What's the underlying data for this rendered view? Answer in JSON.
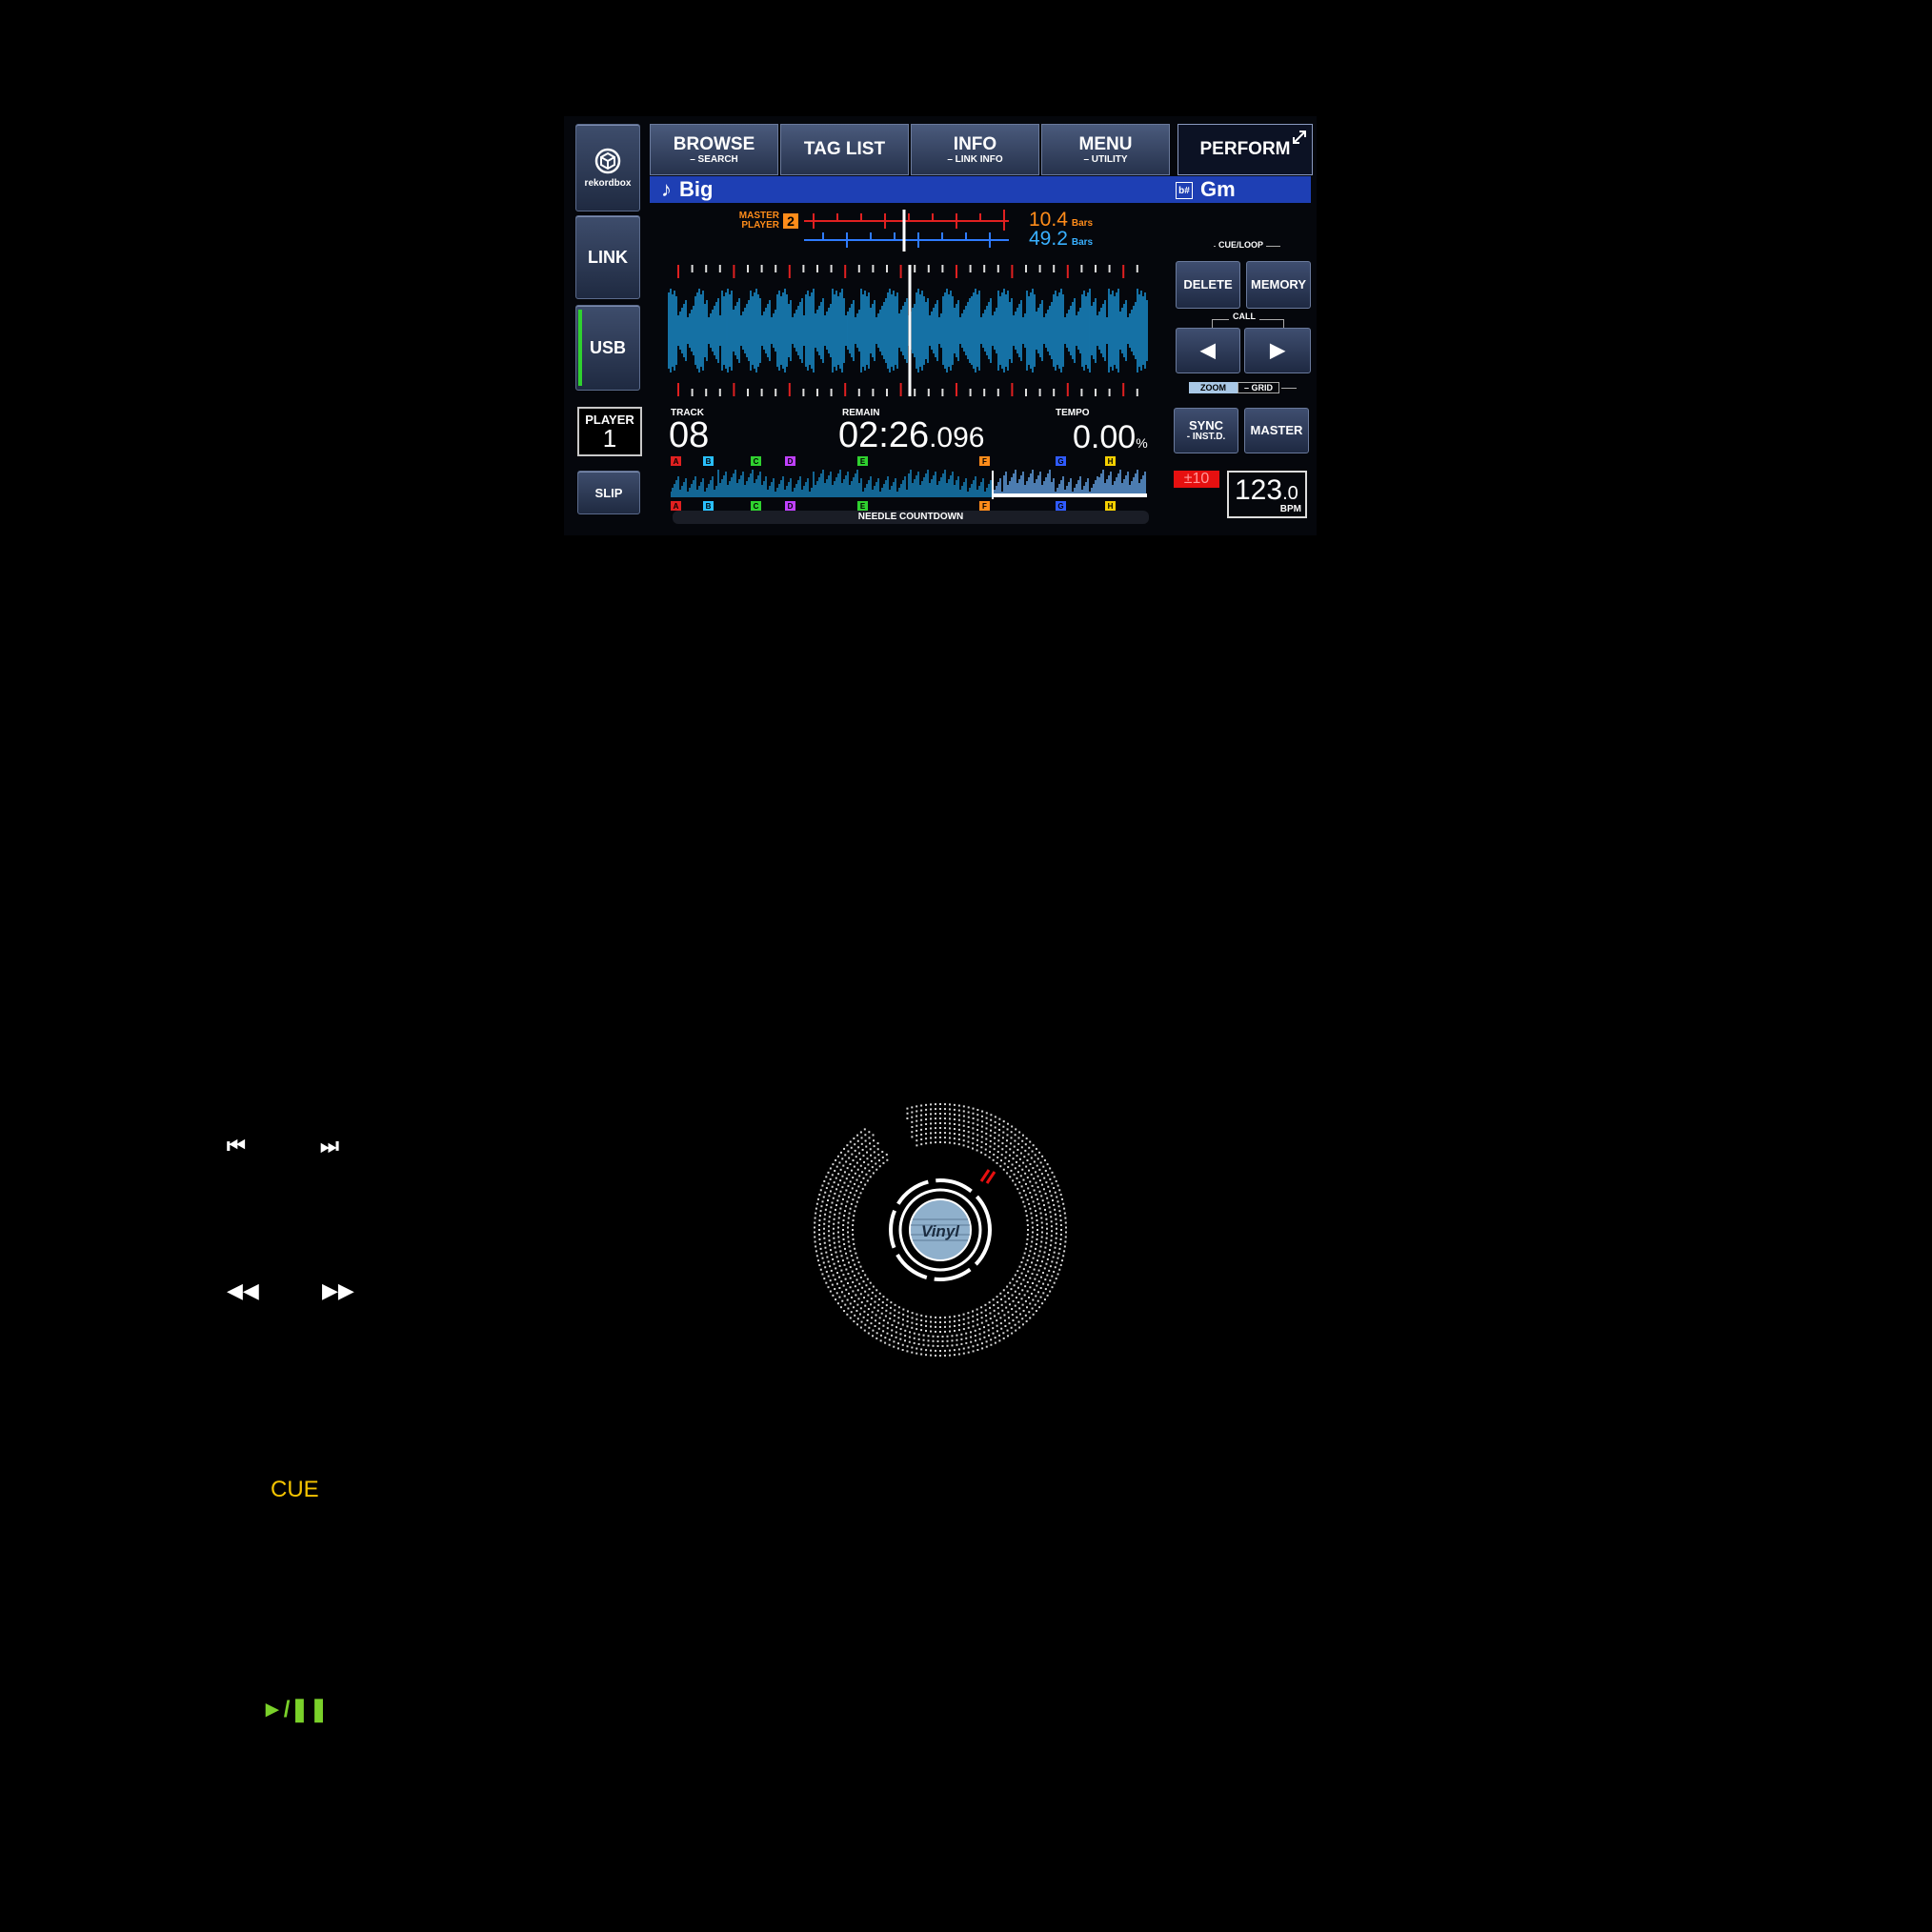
{
  "sidebar": {
    "rekordbox_label": "rekordbox",
    "link_label": "LINK",
    "usb_label": "USB",
    "player_label": "PLAYER",
    "player_number": "1",
    "slip_label": "SLIP"
  },
  "topbar": {
    "browse": {
      "main": "BROWSE",
      "sub": "– SEARCH"
    },
    "taglist": {
      "main": "TAG LIST",
      "sub": ""
    },
    "info": {
      "main": "INFO",
      "sub": "– LINK INFO"
    },
    "menu": {
      "main": "MENU",
      "sub": "– UTILITY"
    },
    "perform": "PERFORM"
  },
  "track_bar": {
    "title": "Big",
    "key": "Gm"
  },
  "beat_info": {
    "master_label_1": "MASTER",
    "master_label_2": "PLAYER",
    "master_player": "2",
    "bars_orange": "10.4",
    "bars_blue": "49.2",
    "bars_unit": "Bars"
  },
  "cue_loop": {
    "header": "CUE/LOOP",
    "delete": "DELETE",
    "memory": "MEMORY",
    "call": "CALL",
    "zoom": "ZOOM",
    "grid": "– GRID"
  },
  "readout": {
    "track_label": "TRACK",
    "track_number": "08",
    "remain_label": "REMAIN",
    "remain_main": "02:26",
    "remain_ms": ".096",
    "tempo_label": "TEMPO",
    "tempo_value": "0.00",
    "tempo_unit": "%",
    "needle_label": "NEEDLE COUNTDOWN"
  },
  "sync": {
    "sync_label": "SYNC",
    "sync_sub": "- INST.D.",
    "master_label": "MASTER",
    "tempo_range": "±10",
    "bpm_value": "123",
    "bpm_decimal": ".0",
    "bpm_unit": "BPM"
  },
  "hot_cues": [
    "A",
    "B",
    "C",
    "D",
    "E",
    "F",
    "G",
    "H"
  ],
  "jog": {
    "center_label": "Vinyl"
  },
  "controls": {
    "cue_label": "CUE",
    "play_pause_glyph": "►/❚❚"
  },
  "colors": {
    "waveform": "#1fb0ff",
    "orange": "#ff8c1a",
    "blue_bars": "#39b0ff",
    "track_bar": "#1e3fb4",
    "cue_yellow": "#f5c400",
    "play_green": "#7ad12a",
    "usb_indicator": "#2fd12f",
    "tempo_red": "#e61010"
  }
}
